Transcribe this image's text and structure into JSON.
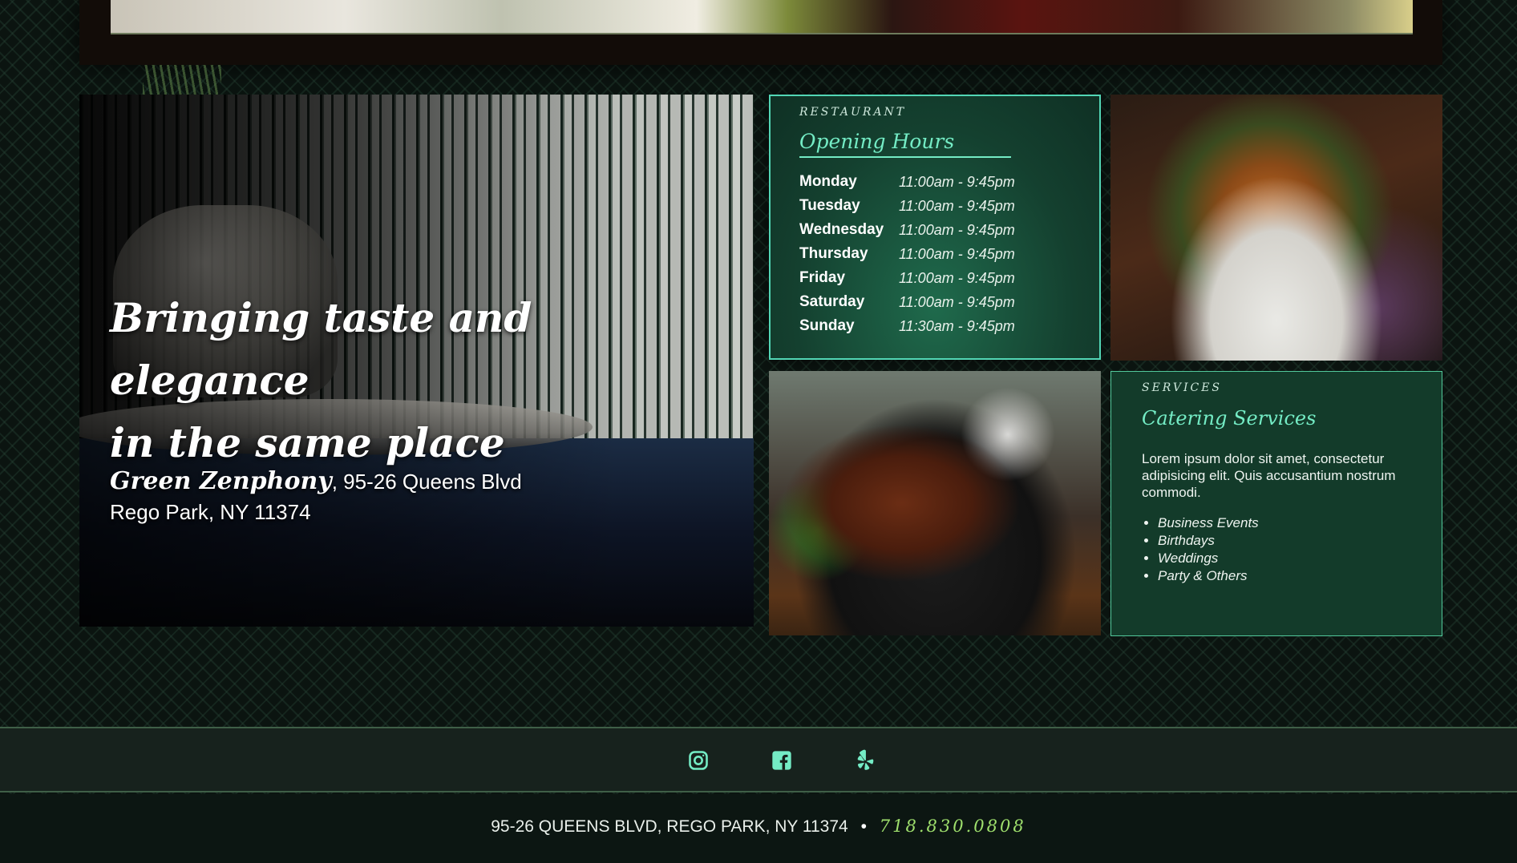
{
  "hero": {
    "tagline": {
      "w1": "Bringing",
      "w2": "taste",
      "w3": "and",
      "w4": "elegance",
      "line2": "in the same place"
    },
    "brand": "Green Zenphony",
    "address_line1": ", 95-26 Queens Blvd",
    "address_line2": "Rego Park, NY 11374"
  },
  "hours": {
    "eyebrow": "RESTAURANT",
    "title": "Opening Hours",
    "rows": [
      {
        "day": "Monday",
        "time": "11:00am - 9:45pm"
      },
      {
        "day": "Tuesday",
        "time": "11:00am - 9:45pm"
      },
      {
        "day": "Wednesday",
        "time": "11:00am - 9:45pm"
      },
      {
        "day": "Thursday",
        "time": "11:00am - 9:45pm"
      },
      {
        "day": "Friday",
        "time": "11:00am - 9:45pm"
      },
      {
        "day": "Saturday",
        "time": "11:00am - 9:45pm"
      },
      {
        "day": "Sunday",
        "time": "11:30am - 9:45pm"
      }
    ]
  },
  "services": {
    "eyebrow": "SERVICES",
    "title": "Catering Services",
    "description": "Lorem ipsum dolor sit amet, consectetur adipisicing elit. Quis accusantium nostrum commodi.",
    "items": [
      "Business Events",
      "Birthdays",
      "Weddings",
      "Party & Others"
    ]
  },
  "social": {
    "icons": [
      "instagram-icon",
      "facebook-icon",
      "yelp-icon"
    ]
  },
  "footer": {
    "address": "95-26 QUEENS BLVD, REGO PARK, NY 11374",
    "separator": "•",
    "phone": "718.830.0808"
  },
  "colors": {
    "accent": "#74ecc5",
    "panel": "#14402f",
    "phone": "#9fe06d"
  }
}
